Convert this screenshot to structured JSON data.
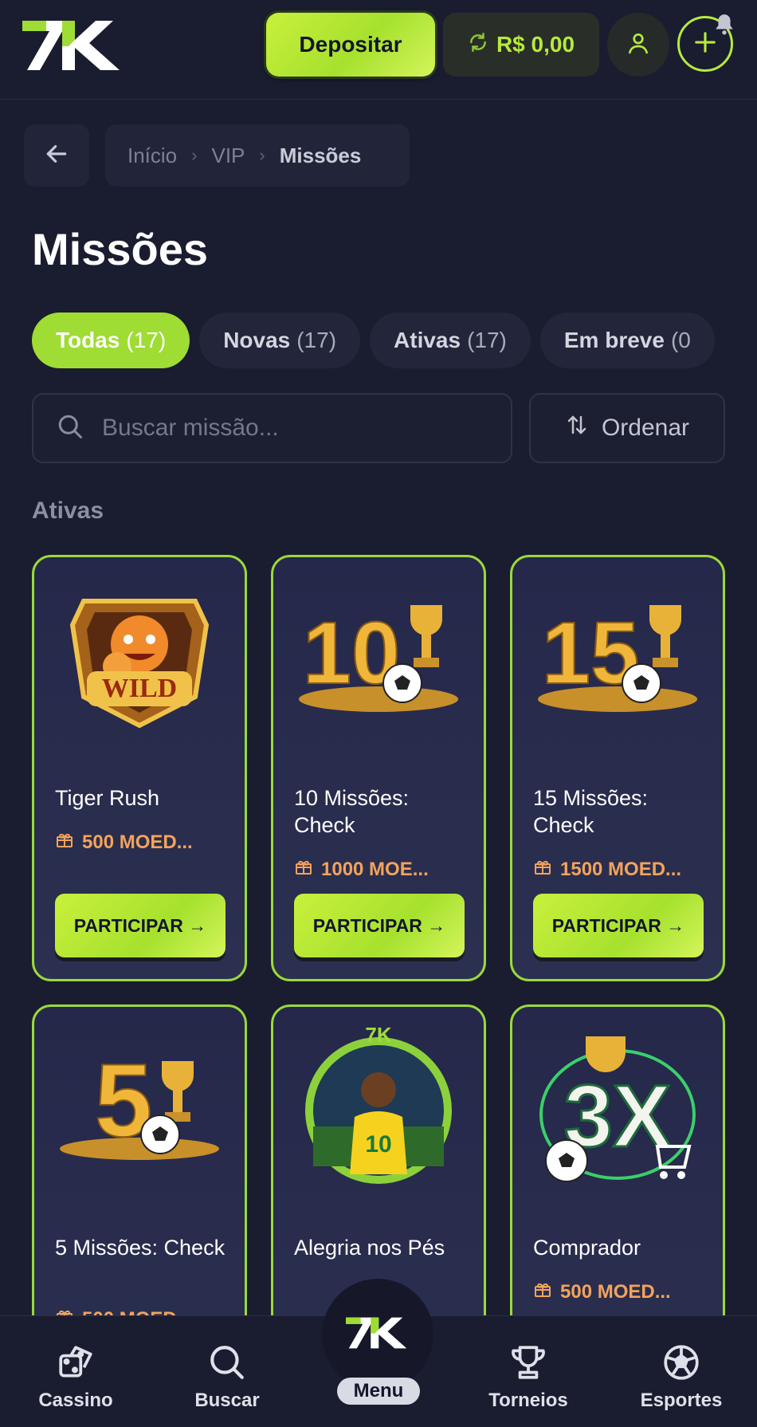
{
  "header": {
    "logo_text": "7K",
    "deposit_label": "Depositar",
    "balance": "R$ 0,00",
    "user_icon": "user-icon",
    "plus_icon": "plus-icon",
    "bell_icon": "bell-icon"
  },
  "breadcrumb": {
    "items": [
      "Início",
      "VIP",
      "Missões"
    ]
  },
  "page_title": "Missões",
  "tabs": [
    {
      "label": "Todas",
      "count": "(17)",
      "active": true
    },
    {
      "label": "Novas",
      "count": "(17)"
    },
    {
      "label": "Ativas",
      "count": "(17)"
    },
    {
      "label": "Em breve",
      "count": "(0"
    }
  ],
  "search": {
    "placeholder": "Buscar missão..."
  },
  "sort_label": "Ordenar",
  "section_label": "Ativas",
  "missions": [
    {
      "title": "Tiger Rush",
      "reward": "500 MOED...",
      "cta": "PARTICIPAR →"
    },
    {
      "title": "10 Missões: Check",
      "reward": "1000 MOE...",
      "cta": "PARTICIPAR →"
    },
    {
      "title": "15 Missões: Check",
      "reward": "1500 MOED...",
      "cta": "PARTICIPAR →"
    },
    {
      "title": "5 Missões: Check",
      "reward": "500 MOED...",
      "cta": ""
    },
    {
      "title": "Alegria nos Pés",
      "reward": "",
      "cta": ""
    },
    {
      "title": "Comprador",
      "reward": "500 MOED...",
      "cta": ""
    }
  ],
  "art_labels": {
    "wild": "WILD",
    "ten": "10",
    "fifteen": "15",
    "five": "5",
    "jersey": "10",
    "three_x": "3X",
    "logo": "7K"
  },
  "bottom_nav": {
    "cassino": "Cassino",
    "buscar": "Buscar",
    "menu": "Menu",
    "torneios": "Torneios",
    "esportes": "Esportes"
  },
  "colors": {
    "accent": "#9fdc34",
    "background": "#1a1c30",
    "reward": "#f3a35b"
  }
}
